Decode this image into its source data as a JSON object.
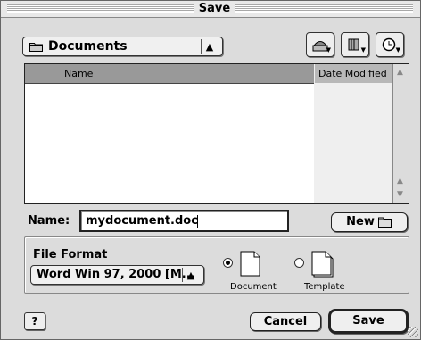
{
  "window": {
    "title": "Save"
  },
  "location": {
    "selected": "Documents"
  },
  "toolbar": {
    "items": [
      "disk-icon",
      "favorites-icon",
      "recent-icon"
    ]
  },
  "file_list": {
    "columns": [
      "Name",
      "Date Modified"
    ],
    "rows": []
  },
  "name_field": {
    "label": "Name:",
    "value": "mydocument.doc"
  },
  "new_folder_button": {
    "label": "New"
  },
  "file_format": {
    "label": "File Format",
    "selected": "Word Win 97, 2000 [M...",
    "options": [
      {
        "label": "Document",
        "selected": true
      },
      {
        "label": "Template",
        "selected": false
      }
    ]
  },
  "footer": {
    "help": "?",
    "cancel_label": "Cancel",
    "save_label": "Save"
  }
}
